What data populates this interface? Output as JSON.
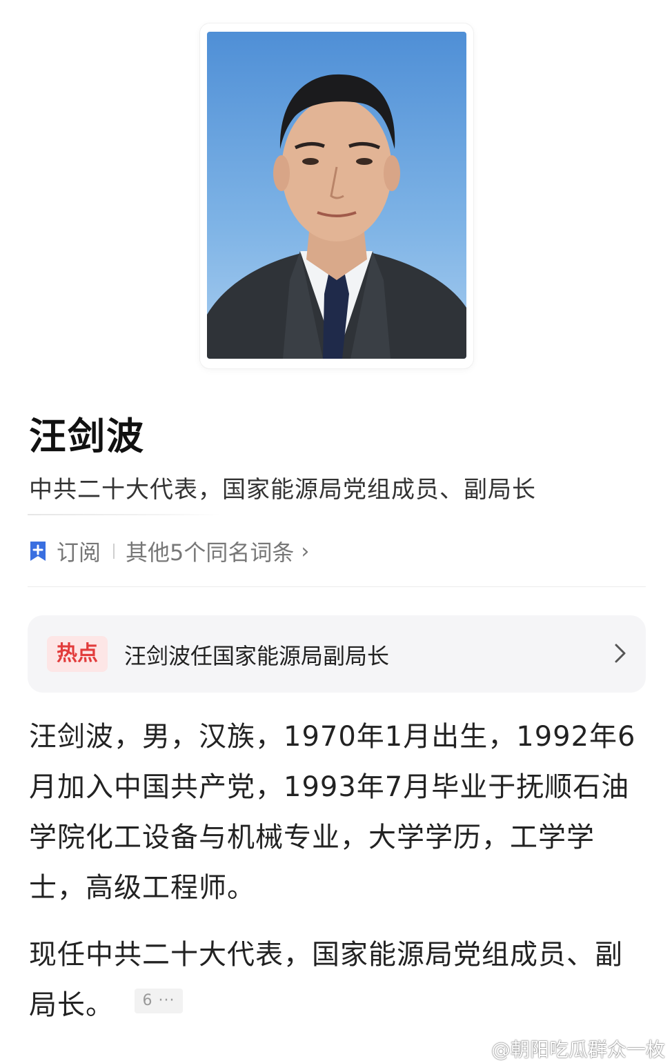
{
  "profile": {
    "name": "汪剑波",
    "subtitle": "中共二十大代表，国家能源局党组成员、副局长"
  },
  "actions": {
    "subscribe_label": "订阅",
    "same_name_label": "其他5个同名词条",
    "chevron": "›"
  },
  "hot": {
    "badge": "热点",
    "title": "汪剑波任国家能源局副局长"
  },
  "intro": {
    "paragraph1": "汪剑波，男，汉族，1970年1月出生，1992年6月加入中国共产党，1993年7月毕业于抚顺石油学院化工设备与机械专业，大学学历，工学学士，高级工程师。",
    "paragraph2": "现任中共二十大代表，国家能源局党组成员、副局长。",
    "reference_badge": "6 ···"
  },
  "watermark": {
    "text": "@朝阳吃瓜群众一枚"
  },
  "colors": {
    "accent_blue": "#3a6fe0",
    "hot_red": "#e23c3c",
    "hot_bg": "#fde6e6",
    "card_bg": "#f5f5f7"
  }
}
